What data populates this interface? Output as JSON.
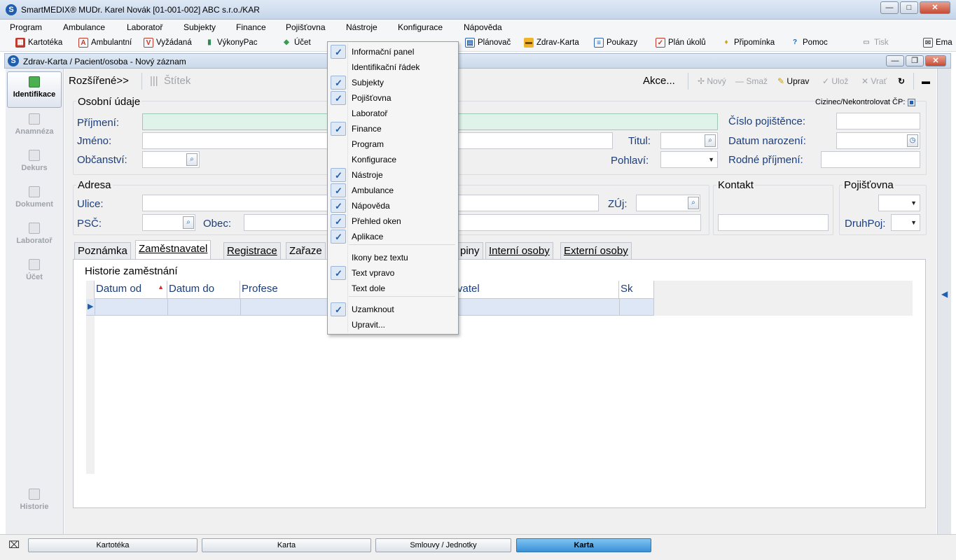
{
  "app": {
    "title": "SmartMEDIX®     MUDr. Karel Novák [01-001-002]     ABC s.r.o./KAR",
    "icon_letter": "S"
  },
  "menu": [
    "Program",
    "Ambulance",
    "Laboratoř",
    "Subjekty",
    "Finance",
    "Pojišťovna",
    "Nástroje",
    "Konfigurace",
    "Nápověda"
  ],
  "toolbar": {
    "items": [
      "Kartotéka",
      "Ambulantní",
      "Vyžádaná",
      "VýkonyPac",
      "Účet",
      "Plánovač",
      "Zdrav-Karta",
      "Poukazy",
      "Plán úkolů",
      "Připomínka",
      "Pomoc",
      "Tisk",
      "Ema"
    ]
  },
  "child": {
    "title": "Zdrav-Karta / Pacient/osoba - Nový záznam"
  },
  "leftnav": [
    "Identifikace",
    "Anamnéza",
    "Dekurs",
    "Dokument",
    "Laboratoř",
    "Účet",
    "Historie"
  ],
  "actions": {
    "rozsirene": "Rozšířené>>",
    "stitek": "Štítek",
    "akce": "Akce...",
    "novy": "Nový",
    "smaz": "Smaž",
    "uprav": "Uprav",
    "uloz": "Ulož",
    "vrat": "Vrať"
  },
  "personal": {
    "group_title": "Osobní údaje",
    "cizinec": "Cizinec/Nekontrolovat ČP:",
    "prijmeni": "Příjmení:",
    "jmeno": "Jméno:",
    "obcanstvi": "Občanství:",
    "titul": "Titul:",
    "pohlavi": "Pohlaví:",
    "cislo_pojistence": "Číslo pojištěnce:",
    "datum_narozeni": "Datum narození:",
    "rodne_prijmeni": "Rodné příjmení:"
  },
  "address": {
    "group_title": "Adresa",
    "ulice": "Ulice:",
    "psc": "PSČ:",
    "obec": "Obec:",
    "zuj": "ZÚj:"
  },
  "contact": {
    "group_title": "Kontakt"
  },
  "insurer": {
    "group_title": "Pojišťovna",
    "druhpoj": "DruhPoj:"
  },
  "tabs": [
    "Poznámka",
    "Zaměstnavatel",
    "Registrace",
    "Zařaze",
    "pinу",
    "Interní osoby",
    "Externí osoby"
  ],
  "history": {
    "title": "Historie zaměstnání",
    "columns": [
      "Datum od",
      "Datum do",
      "Profese",
      "vatel",
      "Sk"
    ]
  },
  "taskbar": [
    "Kartotéka",
    "Karta",
    "Smlouvy / Jednotky",
    "Karta"
  ],
  "context_menu": {
    "items": [
      {
        "label": "Informační panel",
        "checked": true
      },
      {
        "label": "Identifikační řádek",
        "checked": false
      },
      {
        "label": "Subjekty",
        "checked": true
      },
      {
        "label": "Pojišťovna",
        "checked": true
      },
      {
        "label": "Laboratoř",
        "checked": false
      },
      {
        "label": "Finance",
        "checked": true
      },
      {
        "label": "Program",
        "checked": false
      },
      {
        "label": "Konfigurace",
        "checked": false
      },
      {
        "label": "Nástroje",
        "checked": true
      },
      {
        "label": "Ambulance",
        "checked": true
      },
      {
        "label": "Nápověda",
        "checked": true
      },
      {
        "label": "Přehled oken",
        "checked": true
      },
      {
        "label": "Aplikace",
        "checked": true
      },
      {
        "label": "Ikony bez textu",
        "checked": false
      },
      {
        "label": "Text vpravo",
        "checked": true
      },
      {
        "label": "Text dole",
        "checked": false
      },
      {
        "label": "Uzamknout",
        "checked": true
      },
      {
        "label": "Upravit...",
        "checked": false
      }
    ]
  },
  "colors": {
    "accent": "#1f5fae",
    "field_highlight": "#dff3ea",
    "label": "#1a3d7c"
  }
}
